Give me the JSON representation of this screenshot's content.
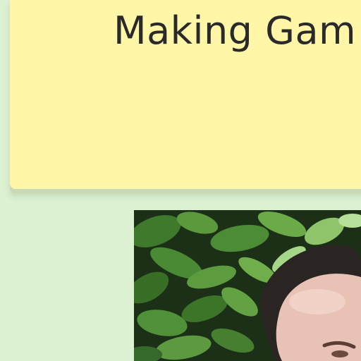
{
  "card": {
    "title": "Making Gam"
  },
  "photo": {
    "subject": "person-in-foliage-photo"
  },
  "colors": {
    "background": "#dcf0d2",
    "card": "#fff6a8",
    "title_text": "#2a2a2a"
  }
}
